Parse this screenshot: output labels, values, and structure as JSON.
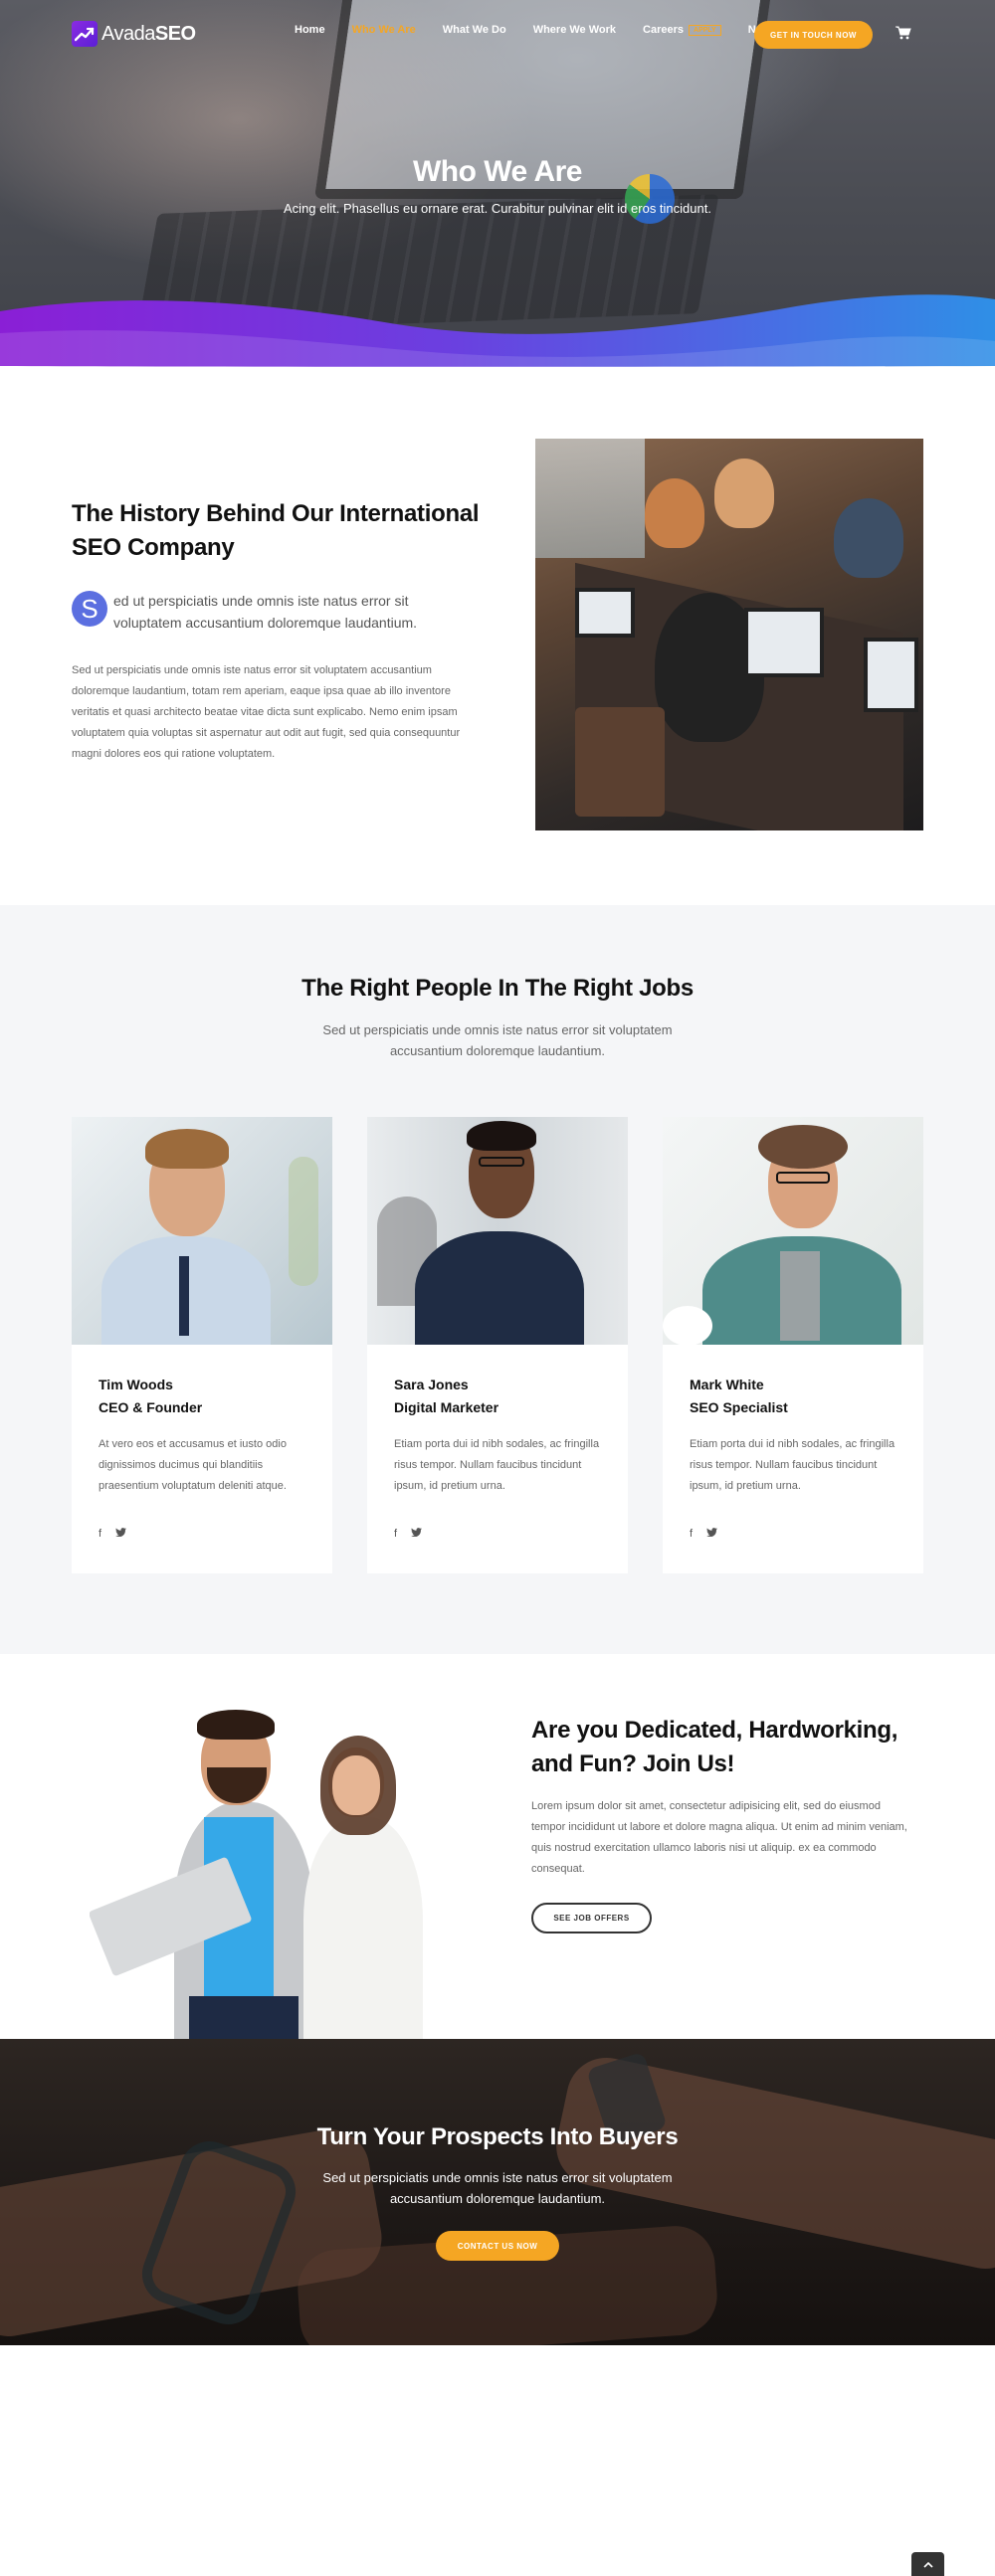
{
  "brand": {
    "name_light": "Avada",
    "name_bold": "SEO",
    "accent": "#f5a623",
    "logo_color": "#7a24e0"
  },
  "nav": {
    "items": [
      {
        "label": "Home",
        "active": false
      },
      {
        "label": "Who We Are",
        "active": true
      },
      {
        "label": "What We Do",
        "active": false
      },
      {
        "label": "Where We Work",
        "active": false
      },
      {
        "label": "Careers",
        "badge": "APPLY",
        "active": false
      },
      {
        "label": "News",
        "active": false
      }
    ],
    "cta": "GET IN TOUCH NOW",
    "cart_icon": "cart-icon"
  },
  "hero": {
    "title": "Who We Are",
    "subtitle": "Acing elit. Phasellus eu ornare erat. Curabitur pulvinar elit id eros tincidunt."
  },
  "history": {
    "title": "The History Behind Our International SEO Company",
    "dropcap": "S",
    "lead": "ed ut perspiciatis unde omnis iste natus error sit voluptatem accusantium doloremque laudantium.",
    "body": "Sed ut perspiciatis unde omnis iste natus error sit voluptatem accusantium doloremque laudantium, totam rem aperiam, eaque ipsa quae ab illo inventore veritatis et quasi architecto beatae vitae dicta sunt explicabo. Nemo enim ipsam voluptatem quia voluptas sit aspernatur aut odit aut fugit, sed quia consequuntur magni dolores eos qui ratione voluptatem."
  },
  "team": {
    "title": "The Right People In The Right Jobs",
    "subtitle": "Sed ut perspiciatis unde omnis iste natus error sit voluptatem accusantium doloremque laudantium.",
    "members": [
      {
        "name": "Tim Woods",
        "role": "CEO & Founder",
        "bio": "At vero eos et accusamus et iusto odio dignissimos ducimus qui blanditiis praesentium voluptatum deleniti atque.",
        "facebook": "f",
        "twitter": "t"
      },
      {
        "name": "Sara Jones",
        "role": "Digital Marketer",
        "bio": "Etiam porta dui id nibh sodales, ac fringilla risus tempor. Nullam faucibus tincidunt ipsum, id pretium urna.",
        "facebook": "f",
        "twitter": "t"
      },
      {
        "name": "Mark White",
        "role": "SEO Specialist",
        "bio": "Etiam porta dui id nibh sodales, ac fringilla risus tempor. Nullam faucibus tincidunt ipsum, id pretium urna.",
        "facebook": "f",
        "twitter": "t"
      }
    ]
  },
  "join": {
    "title": "Are you Dedicated, Hardworking, and Fun? Join Us!",
    "body": "Lorem ipsum dolor sit amet, consectetur adipisicing elit, sed do eiusmod tempor incididunt ut labore et dolore magna aliqua. Ut enim ad minim veniam, quis nostrud exercitation ullamco laboris nisi ut aliquip. ex ea commodo consequat.",
    "button": "SEE JOB OFFERS"
  },
  "prospects": {
    "title": "Turn Your Prospects Into Buyers",
    "subtitle": "Sed ut perspiciatis unde omnis iste natus error sit voluptatem accusantium doloremque laudantium.",
    "button": "CONTACT US NOW"
  }
}
